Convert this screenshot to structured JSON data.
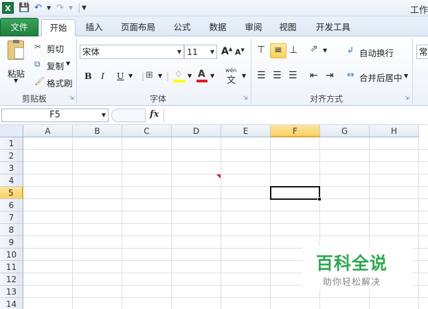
{
  "quick_access": {
    "app_icon": "excel-icon",
    "save_icon": "save-icon",
    "undo_icon": "undo-icon",
    "redo_icon": "redo-icon",
    "customize_icon": "customize-dropdown-icon",
    "title_partial": "工作"
  },
  "tabs": [
    "文件",
    "开始",
    "插入",
    "页面布局",
    "公式",
    "数据",
    "审阅",
    "视图",
    "开发工具"
  ],
  "active_tab": "开始",
  "ribbon": {
    "clipboard": {
      "paste": "粘贴",
      "cut": "剪切",
      "copy": "复制",
      "format_painter": "格式刷",
      "group_label": "剪贴板"
    },
    "font": {
      "font_name": "宋体",
      "font_size": "11",
      "bold": "B",
      "italic": "I",
      "underline": "U",
      "phonetic": "wén",
      "group_label": "字体"
    },
    "alignment": {
      "wrap_text": "自动换行",
      "merge_center": "合并后居中",
      "group_label": "对齐方式"
    },
    "number_partial": "常"
  },
  "formula_bar": {
    "name_box": "F5",
    "fx": "fx",
    "formula": ""
  },
  "sheet": {
    "columns": [
      "A",
      "B",
      "C",
      "D",
      "E",
      "F",
      "G",
      "H"
    ],
    "rows": [
      "1",
      "2",
      "3",
      "4",
      "5",
      "6",
      "7",
      "8",
      "9",
      "10",
      "11",
      "12",
      "13",
      "14"
    ],
    "selected_cell": "F5"
  },
  "watermark": {
    "title": "百科全说",
    "subtitle": "助你轻松解决"
  },
  "colors": {
    "file_tab": "#1e7f3c",
    "selection_header": "#f9d265",
    "watermark_green": "#2fa84f"
  }
}
